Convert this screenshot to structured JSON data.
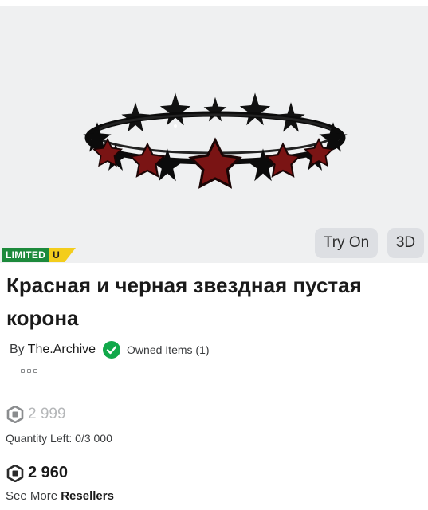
{
  "item": {
    "name": "Красная и черная звездная пустая корона",
    "badges": {
      "limited": "LIMITED",
      "unique": "U"
    },
    "preview_alt_icon": "crown-image"
  },
  "preview_controls": {
    "try_on": "Try On",
    "three_d": "3D"
  },
  "creator": {
    "prefix": "By",
    "name": "The.Archive",
    "verified_icon": "verified-check-icon",
    "owned_items": "Owned Items (1)"
  },
  "pricing": {
    "original_price": "2 999",
    "quantity_left": "Quantity Left: 0/3 000",
    "resale_price": "2 960",
    "see_more_prefix": "See More",
    "resellers_link": "Resellers",
    "currency_icon": "robux-icon"
  },
  "colors": {
    "limited_badge": "#1d8a3c",
    "unique_badge": "#f3cd1c",
    "verified": "#11a84a",
    "preview_bg": "#eff0f1"
  }
}
